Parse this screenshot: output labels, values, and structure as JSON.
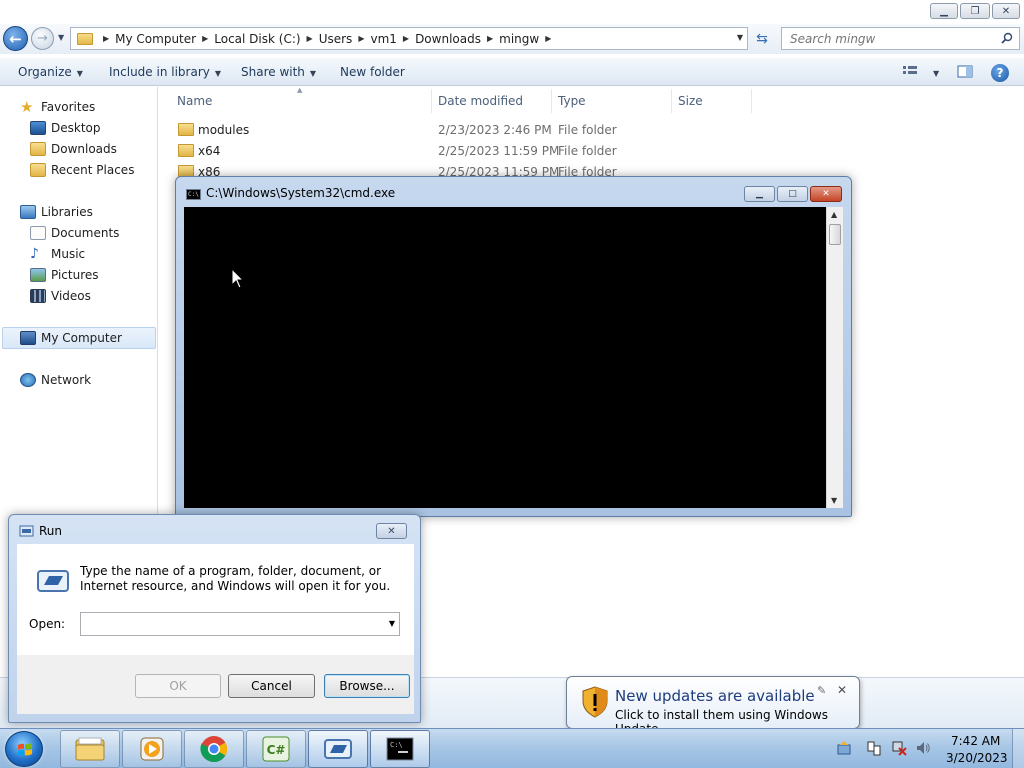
{
  "explorer": {
    "breadcrumbs": [
      "My Computer",
      "Local Disk (C:)",
      "Users",
      "vm1",
      "Downloads",
      "mingw"
    ],
    "search_placeholder": "Search mingw",
    "toolbar": {
      "organize": "Organize",
      "include_library": "Include in library",
      "share_with": "Share with",
      "new_folder": "New folder"
    },
    "nav": {
      "favorites": "Favorites",
      "desktop": "Desktop",
      "downloads": "Downloads",
      "recent_places": "Recent Places",
      "libraries": "Libraries",
      "documents": "Documents",
      "music": "Music",
      "pictures": "Pictures",
      "videos": "Videos",
      "my_computer": "My Computer",
      "network": "Network"
    },
    "columns": {
      "name": "Name",
      "date": "Date modified",
      "type": "Type",
      "size": "Size"
    },
    "files": [
      {
        "name": "modules",
        "date": "2/23/2023 2:46 PM",
        "type": "File folder"
      },
      {
        "name": "x64",
        "date": "2/25/2023 11:59 PM",
        "type": "File folder"
      },
      {
        "name": "x86",
        "date": "2/25/2023 11:59 PM",
        "type": "File folder"
      }
    ]
  },
  "cmd": {
    "title": "C:\\Windows\\System32\\cmd.exe"
  },
  "run": {
    "title": "Run",
    "description": "Type the name of a program, folder, document, or Internet resource, and Windows will open it for you.",
    "open_label": "Open:",
    "open_value": "",
    "ok": "OK",
    "cancel": "Cancel",
    "browse": "Browse..."
  },
  "notification": {
    "title": "New updates are available",
    "text": "Click to install them using Windows Update."
  },
  "taskbar": {
    "time": "7:42 AM",
    "date": "3/20/2023"
  },
  "colors": {
    "taskbar": "#a8c7e6",
    "close_red": "#c44527",
    "link_blue": "#1d3c7e"
  }
}
